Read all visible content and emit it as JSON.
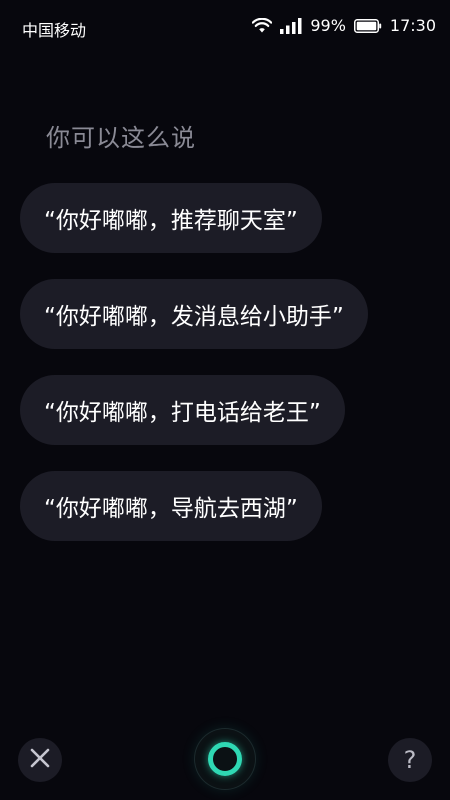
{
  "status_bar": {
    "carrier": "中国移动",
    "battery": "99%",
    "time": "17:30",
    "icons": [
      "wifi-icon",
      "signal-icon",
      "battery-icon"
    ]
  },
  "prompt": {
    "title": "你可以这么说"
  },
  "suggestions": [
    "“你好嘟嘟，推荐聊天室”",
    "“你好嘟嘟，发消息给小助手”",
    "“你好嘟嘟，打电话给老王”",
    "“你好嘟嘟，导航去西湖”"
  ],
  "bottom_bar": {
    "close_icon": "close-icon",
    "voice_icon": "voice-ring-icon",
    "help_label": "?"
  },
  "colors": {
    "background": "#07070d",
    "pill": "#1c1c26",
    "accent": "#2fd8b3",
    "muted_text": "#8a8a95"
  }
}
